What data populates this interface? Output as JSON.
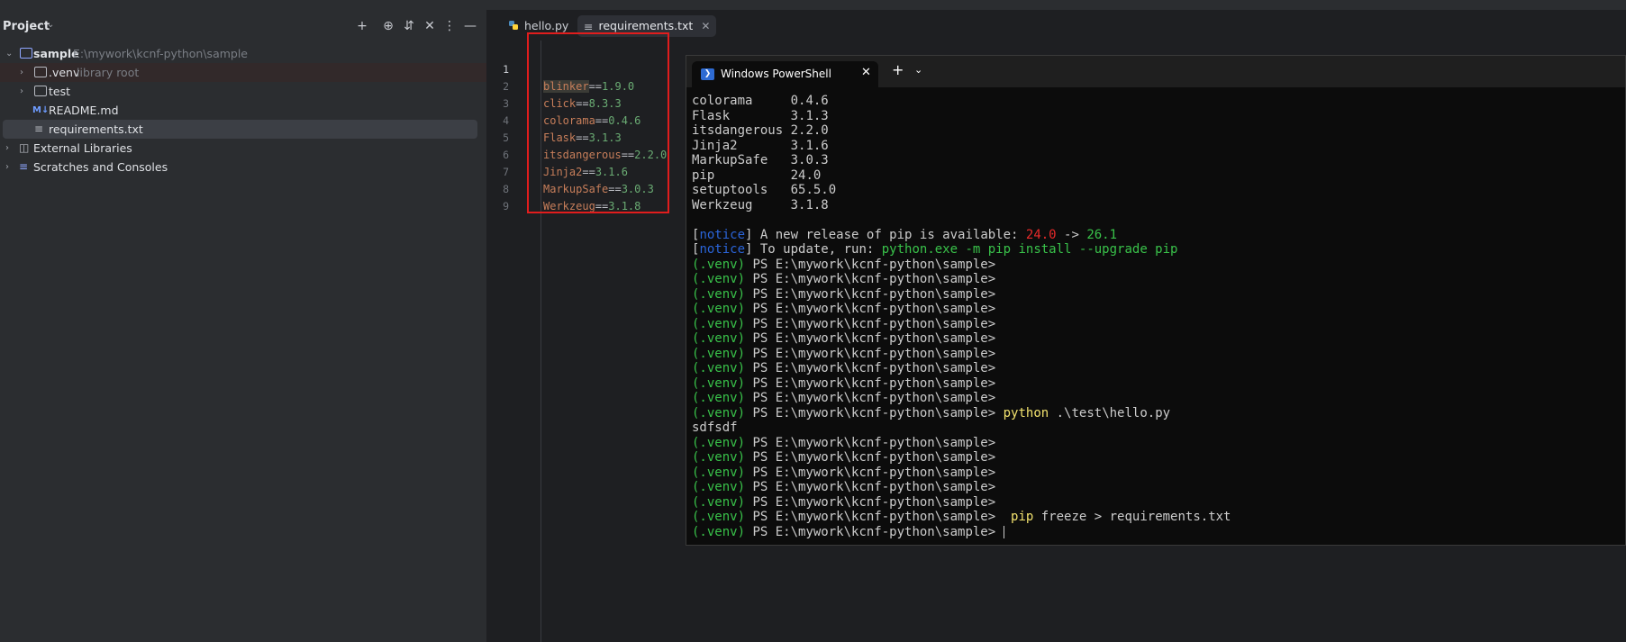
{
  "project_panel": {
    "title": "Project",
    "tree": [
      {
        "label": "sample",
        "hint": "E:\\mywork\\kcnf-python\\sample",
        "icon": "project-folder-icon"
      },
      {
        "label": ".venv",
        "hint": "library root",
        "icon": "folder-icon"
      },
      {
        "label": "test",
        "hint": "",
        "icon": "folder-icon"
      },
      {
        "label": "README.md",
        "hint": "",
        "icon": "markdown-icon"
      },
      {
        "label": "requirements.txt",
        "hint": "",
        "icon": "text-file-icon"
      },
      {
        "label": "External Libraries",
        "hint": "",
        "icon": "libraries-icon"
      },
      {
        "label": "Scratches and Consoles",
        "hint": "",
        "icon": "scratches-icon"
      }
    ]
  },
  "editor": {
    "tabs": [
      {
        "label": "hello.py",
        "icon": "python-file-icon",
        "active": false
      },
      {
        "label": "requirements.txt",
        "icon": "text-file-icon",
        "active": true
      }
    ],
    "lines": [
      {
        "num": "1",
        "pkg": "blinker",
        "op": "==",
        "ver": "1.9.0"
      },
      {
        "num": "2",
        "pkg": "click",
        "op": "==",
        "ver": "8.3.3"
      },
      {
        "num": "3",
        "pkg": "colorama",
        "op": "==",
        "ver": "0.4.6"
      },
      {
        "num": "4",
        "pkg": "Flask",
        "op": "==",
        "ver": "3.1.3"
      },
      {
        "num": "5",
        "pkg": "itsdangerous",
        "op": "==",
        "ver": "2.2.0"
      },
      {
        "num": "6",
        "pkg": "Jinja2",
        "op": "==",
        "ver": "3.1.6"
      },
      {
        "num": "7",
        "pkg": "MarkupSafe",
        "op": "==",
        "ver": "3.0.3"
      },
      {
        "num": "8",
        "pkg": "Werkzeug",
        "op": "==",
        "ver": "3.1.8"
      },
      {
        "num": "9",
        "pkg": "",
        "op": "",
        "ver": ""
      }
    ]
  },
  "terminal": {
    "tab_title": "Windows PowerShell",
    "close_glyph": "✕",
    "new_tab_glyph": "+",
    "dropdown_glyph": "⌄",
    "packages": [
      {
        "name": "colorama    ",
        "ver": " 0.4.6"
      },
      {
        "name": "Flask       ",
        "ver": " 3.1.3"
      },
      {
        "name": "itsdangerous",
        "ver": " 2.2.0"
      },
      {
        "name": "Jinja2      ",
        "ver": " 3.1.6"
      },
      {
        "name": "MarkupSafe  ",
        "ver": " 3.0.3"
      },
      {
        "name": "pip         ",
        "ver": " 24.0"
      },
      {
        "name": "setuptools  ",
        "ver": " 65.5.0"
      },
      {
        "name": "Werkzeug    ",
        "ver": " 3.1.8"
      }
    ],
    "notice1": {
      "open": "[",
      "tag": "notice",
      "close": "]",
      "text": " A new release of pip is available: ",
      "old": "24.0",
      "arrow": " -> ",
      "new": "26.1"
    },
    "notice2": {
      "open": "[",
      "tag": "notice",
      "close": "]",
      "text": " To update, run: ",
      "cmd": "python.exe -m pip install --upgrade pip"
    },
    "venv": "(.venv)",
    "prompt": " PS E:\\mywork\\kcnf-python\\sample>",
    "cmd_python": {
      "exe": "python",
      "args": " .\\test\\hello.py"
    },
    "output": "sdfsdf",
    "cmd_pip": {
      "exe": "pip",
      "args": " freeze > requirements.txt"
    }
  }
}
